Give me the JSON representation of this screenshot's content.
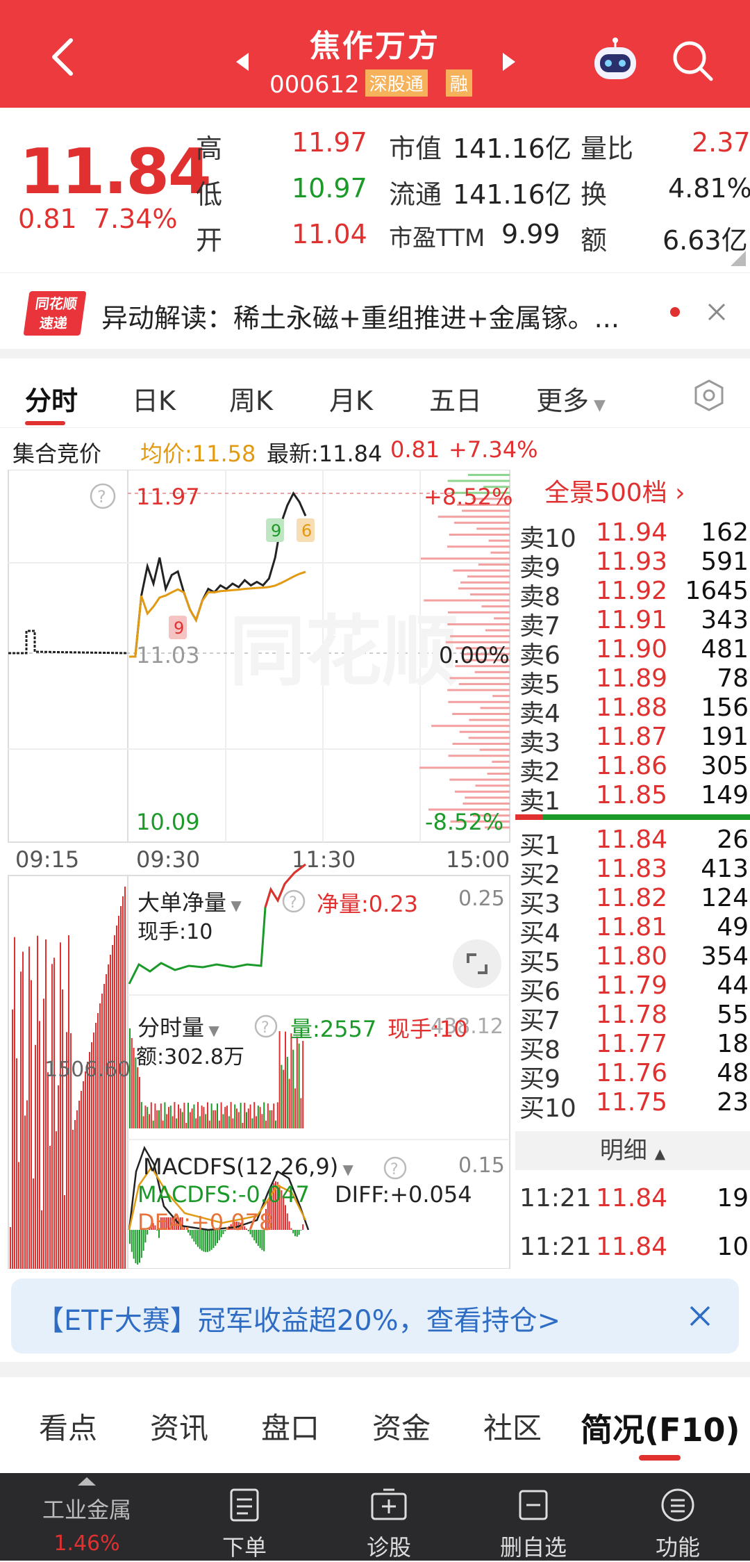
{
  "header": {
    "title": "焦作万方",
    "code": "000612",
    "tag": "深股通",
    "tag2": "融",
    "bg_color": "#ec3a3f"
  },
  "quote": {
    "price": "11.84",
    "change": "0.81",
    "change_pct": "7.34%",
    "high_label": "高",
    "high": "11.97",
    "low_label": "低",
    "low": "10.97",
    "open_label": "开",
    "open": "11.04",
    "mktcap_label": "市值",
    "mktcap": "141.16亿",
    "float_label": "流通",
    "float": "141.16亿",
    "pe_label": "市盈TTM",
    "pe": "9.99",
    "volratio_label": "量比",
    "volratio": "2.37",
    "turnover_label": "换",
    "turnover": "4.81%",
    "amount_label": "额",
    "amount": "6.63亿"
  },
  "notice": {
    "logo_top": "同花顺",
    "logo_bottom": "速递",
    "text": "异动解读：稀土永磁+重组推进+金属镓。..."
  },
  "tabs": [
    "分时",
    "日K",
    "周K",
    "月K",
    "五日",
    "更多"
  ],
  "infobar": {
    "label": "集合竞价",
    "avg": "均价:11.58",
    "latest": "最新:11.84",
    "chg": "0.81",
    "pct": "+7.34%"
  },
  "chart": {
    "top_price": "11.97",
    "mid_price": "11.03",
    "bot_price": "10.09",
    "top_pct": "+8.52%",
    "mid_pct": "0.00%",
    "bot_pct": "-8.52%",
    "time_labels": [
      "09:15",
      "09:30",
      "11:30",
      "15:00"
    ],
    "watermark": "同花顺",
    "markers": [
      "9",
      "6",
      "9"
    ],
    "flow_title": "大单净量",
    "flow_val": "净量:0.23",
    "flow_hand": "现手:10",
    "flow_scale": "0.25",
    "vol_title": "分时量",
    "vol_val": "量:2557",
    "vol_hand": "现手:10",
    "vol_amt": "额:302.8万",
    "vol_scale": "438.12",
    "vol_left": "1506.60",
    "macd_title": "MACDFS(12,26,9)",
    "macd_val": "MACDFS:-0.047",
    "diff": "DIFF:+0.054",
    "dea": "DEA:+0.078",
    "macd_scale": "0.15",
    "price_series": [
      11.03,
      11.03,
      11.38,
      11.55,
      11.45,
      11.6,
      11.42,
      11.5,
      11.52,
      11.4,
      11.3,
      11.24,
      11.35,
      11.42,
      11.4,
      11.44,
      11.42,
      11.45,
      11.43,
      11.47,
      11.44,
      11.46,
      11.44,
      11.48,
      11.6,
      11.8,
      11.9,
      11.97,
      11.92,
      11.84
    ]
  },
  "book": {
    "header": "全景500档",
    "sells": [
      {
        "label": "卖10",
        "price": "11.94",
        "vol": "162"
      },
      {
        "label": "卖9",
        "price": "11.93",
        "vol": "591"
      },
      {
        "label": "卖8",
        "price": "11.92",
        "vol": "1645"
      },
      {
        "label": "卖7",
        "price": "11.91",
        "vol": "343"
      },
      {
        "label": "卖6",
        "price": "11.90",
        "vol": "481"
      },
      {
        "label": "卖5",
        "price": "11.89",
        "vol": "78"
      },
      {
        "label": "卖4",
        "price": "11.88",
        "vol": "156"
      },
      {
        "label": "卖3",
        "price": "11.87",
        "vol": "191"
      },
      {
        "label": "卖2",
        "price": "11.86",
        "vol": "305"
      },
      {
        "label": "卖1",
        "price": "11.85",
        "vol": "149"
      }
    ],
    "buys": [
      {
        "label": "买1",
        "price": "11.84",
        "vol": "26"
      },
      {
        "label": "买2",
        "price": "11.83",
        "vol": "413"
      },
      {
        "label": "买3",
        "price": "11.82",
        "vol": "124"
      },
      {
        "label": "买4",
        "price": "11.81",
        "vol": "49"
      },
      {
        "label": "买5",
        "price": "11.80",
        "vol": "354"
      },
      {
        "label": "买6",
        "price": "11.79",
        "vol": "44"
      },
      {
        "label": "买7",
        "price": "11.78",
        "vol": "55"
      },
      {
        "label": "买8",
        "price": "11.77",
        "vol": "18"
      },
      {
        "label": "买9",
        "price": "11.76",
        "vol": "48"
      },
      {
        "label": "买10",
        "price": "11.75",
        "vol": "23"
      }
    ],
    "detail_label": "明细",
    "trades": [
      {
        "time": "11:21",
        "price": "11.84",
        "vol": "19"
      },
      {
        "time": "11:21",
        "price": "11.84",
        "vol": "10"
      }
    ]
  },
  "etf": {
    "text": "【ETF大赛】冠军收益超20%，查看持仓>"
  },
  "subtabs": [
    "看点",
    "资讯",
    "盘口",
    "资金",
    "社区",
    "简况(F10)"
  ],
  "bottom": {
    "sector": "工业金属",
    "sector_pct": "1.46%",
    "items": [
      "下单",
      "诊股",
      "删自选",
      "功能"
    ]
  }
}
